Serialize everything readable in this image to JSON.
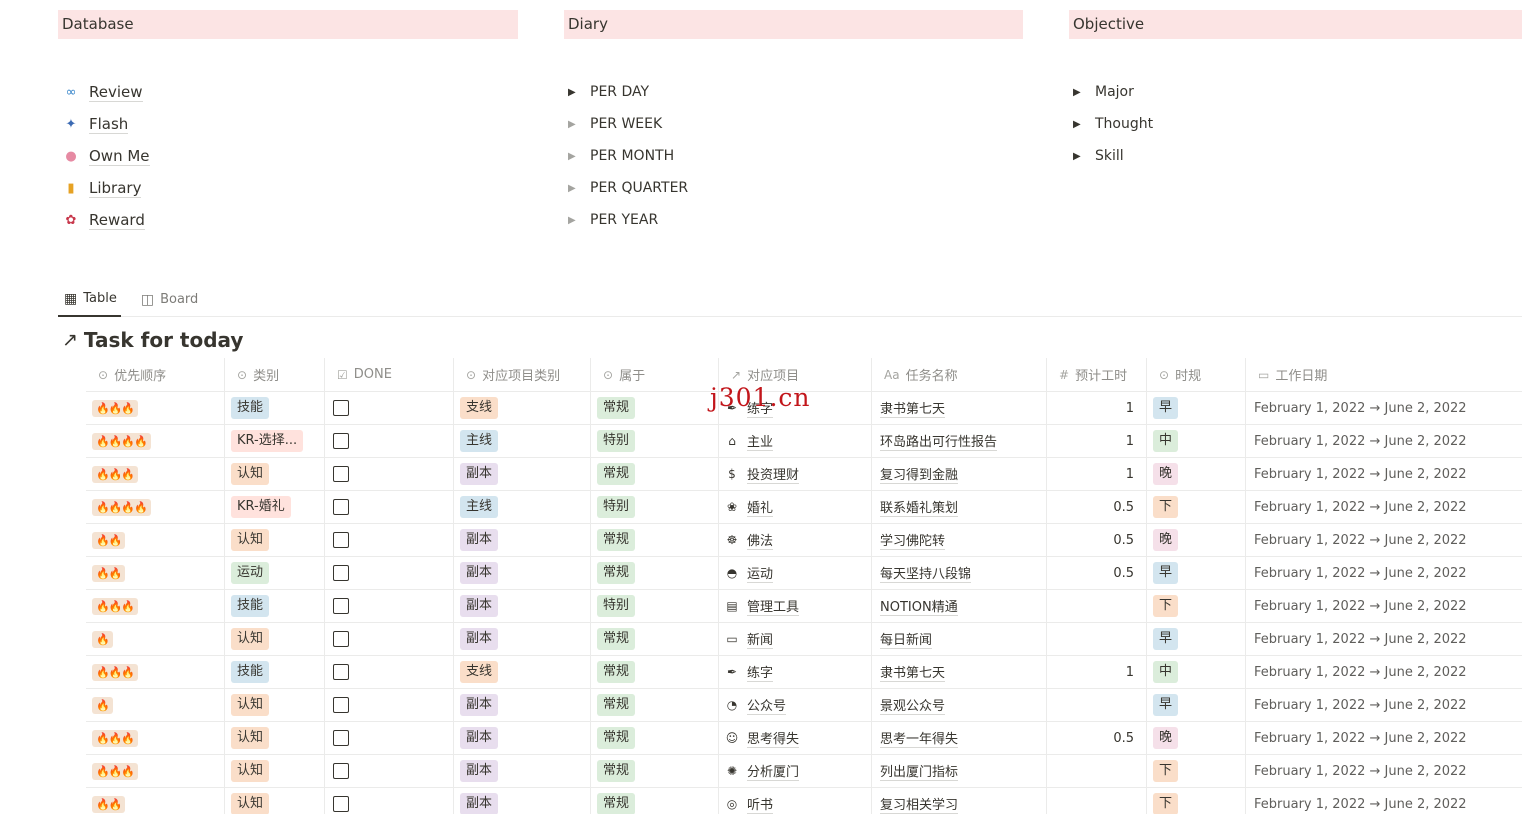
{
  "columns": {
    "database": {
      "title": "Database",
      "items": [
        {
          "icon": "infinity-icon",
          "glyph": "∞",
          "color": "#2f80c8",
          "label": "Review"
        },
        {
          "icon": "night-sky-icon",
          "glyph": "✦",
          "color": "#3b6ab3",
          "label": "Flash"
        },
        {
          "icon": "brain-icon",
          "glyph": "●",
          "color": "#e68aa3",
          "label": "Own Me"
        },
        {
          "icon": "books-icon",
          "glyph": "▮",
          "color": "#e6a224",
          "label": "Library"
        },
        {
          "icon": "candy-icon",
          "glyph": "✿",
          "color": "#c8384c",
          "label": "Reward"
        }
      ]
    },
    "diary": {
      "title": "Diary",
      "items": [
        "PER DAY",
        "PER WEEK",
        "PER MONTH",
        "PER QUARTER",
        "PER YEAR"
      ]
    },
    "objective": {
      "title": "Objective",
      "items": [
        "Major",
        "Thought",
        "Skill"
      ]
    }
  },
  "views": [
    {
      "icon": "table-icon",
      "glyph": "▦",
      "label": "Table",
      "active": true
    },
    {
      "icon": "board-icon",
      "glyph": "◫",
      "label": "Board",
      "active": false
    }
  ],
  "database_title": "Task for today",
  "table": {
    "headers": [
      {
        "icon": "select-icon",
        "glyph": "⊙",
        "label": "优先顺序"
      },
      {
        "icon": "select-icon",
        "glyph": "⊙",
        "label": "类别"
      },
      {
        "icon": "checkbox-icon",
        "glyph": "☑",
        "label": "DONE"
      },
      {
        "icon": "select-icon",
        "glyph": "⊙",
        "label": "对应项目类别"
      },
      {
        "icon": "select-icon",
        "glyph": "⊙",
        "label": "属于"
      },
      {
        "icon": "relation-icon",
        "glyph": "↗",
        "label": "对应项目"
      },
      {
        "icon": "title-icon",
        "glyph": "Aa",
        "label": "任务名称"
      },
      {
        "icon": "number-icon",
        "glyph": "#",
        "label": "预计工时"
      },
      {
        "icon": "select-icon",
        "glyph": "⊙",
        "label": "时规"
      },
      {
        "icon": "calendar-icon",
        "glyph": "▭",
        "label": "工作日期"
      }
    ],
    "rows": [
      {
        "priority": "🔥🔥🔥",
        "category": "技能",
        "catColor": "blue",
        "done": false,
        "projType": "支线",
        "ptColor": "orange",
        "belongs": "常规",
        "project": "练字",
        "picon": "✒",
        "task": "隶书第七天",
        "hours": "1",
        "slot": "早",
        "slotColor": "blue",
        "dates": "February 1, 2022 → June 2, 2022"
      },
      {
        "priority": "🔥🔥🔥🔥",
        "category": "KR-选择...",
        "catColor": "red",
        "done": false,
        "projType": "主线",
        "ptColor": "blue",
        "belongs": "特别",
        "project": "主业",
        "picon": "⌂",
        "task": "环岛路出可行性报告",
        "hours": "1",
        "slot": "中",
        "slotColor": "green",
        "dates": "February 1, 2022 → June 2, 2022"
      },
      {
        "priority": "🔥🔥🔥",
        "category": "认知",
        "catColor": "orange",
        "done": false,
        "projType": "副本",
        "ptColor": "purple",
        "belongs": "常规",
        "project": "投资理财",
        "picon": "$",
        "task": "复习得到金融",
        "hours": "1",
        "slot": "晚",
        "slotColor": "pink",
        "dates": "February 1, 2022 → June 2, 2022"
      },
      {
        "priority": "🔥🔥🔥🔥",
        "category": "KR-婚礼",
        "catColor": "red",
        "done": false,
        "projType": "主线",
        "ptColor": "blue",
        "belongs": "特别",
        "project": "婚礼",
        "picon": "❀",
        "task": "联系婚礼策划",
        "hours": "0.5",
        "slot": "下",
        "slotColor": "orange",
        "dates": "February 1, 2022 → June 2, 2022"
      },
      {
        "priority": "🔥🔥",
        "category": "认知",
        "catColor": "orange",
        "done": false,
        "projType": "副本",
        "ptColor": "purple",
        "belongs": "常规",
        "project": "佛法",
        "picon": "☸",
        "task": "学习佛陀转",
        "hours": "0.5",
        "slot": "晚",
        "slotColor": "pink",
        "dates": "February 1, 2022 → June 2, 2022"
      },
      {
        "priority": "🔥🔥",
        "category": "运动",
        "catColor": "green",
        "done": false,
        "projType": "副本",
        "ptColor": "purple",
        "belongs": "常规",
        "project": "运动",
        "picon": "◓",
        "task": "每天坚持八段锦",
        "hours": "0.5",
        "slot": "早",
        "slotColor": "blue",
        "dates": "February 1, 2022 → June 2, 2022"
      },
      {
        "priority": "🔥🔥🔥",
        "category": "技能",
        "catColor": "blue",
        "done": false,
        "projType": "副本",
        "ptColor": "purple",
        "belongs": "特别",
        "project": "管理工具",
        "picon": "▤",
        "task": "NOTION精通",
        "hours": "",
        "slot": "下",
        "slotColor": "orange",
        "dates": "February 1, 2022 → June 2, 2022"
      },
      {
        "priority": "🔥",
        "category": "认知",
        "catColor": "orange",
        "done": false,
        "projType": "副本",
        "ptColor": "purple",
        "belongs": "常规",
        "project": "新闻",
        "picon": "▭",
        "task": "每日新闻",
        "hours": "",
        "slot": "早",
        "slotColor": "blue",
        "dates": "February 1, 2022 → June 2, 2022"
      },
      {
        "priority": "🔥🔥🔥",
        "category": "技能",
        "catColor": "blue",
        "done": false,
        "projType": "支线",
        "ptColor": "orange",
        "belongs": "常规",
        "project": "练字",
        "picon": "✒",
        "task": "隶书第七天",
        "hours": "1",
        "slot": "中",
        "slotColor": "green",
        "dates": "February 1, 2022 → June 2, 2022"
      },
      {
        "priority": "🔥",
        "category": "认知",
        "catColor": "orange",
        "done": false,
        "projType": "副本",
        "ptColor": "purple",
        "belongs": "常规",
        "project": "公众号",
        "picon": "◔",
        "task": "景观公众号",
        "hours": "",
        "slot": "早",
        "slotColor": "blue",
        "dates": "February 1, 2022 → June 2, 2022"
      },
      {
        "priority": "🔥🔥🔥",
        "category": "认知",
        "catColor": "orange",
        "done": false,
        "projType": "副本",
        "ptColor": "purple",
        "belongs": "常规",
        "project": "思考得失",
        "picon": "☺",
        "task": "思考一年得失",
        "hours": "0.5",
        "slot": "晚",
        "slotColor": "pink",
        "dates": "February 1, 2022 → June 2, 2022"
      },
      {
        "priority": "🔥🔥🔥",
        "category": "认知",
        "catColor": "orange",
        "done": false,
        "projType": "副本",
        "ptColor": "purple",
        "belongs": "常规",
        "project": "分析厦门",
        "picon": "✺",
        "task": "列出厦门指标",
        "hours": "",
        "slot": "下",
        "slotColor": "orange",
        "dates": "February 1, 2022 → June 2, 2022"
      },
      {
        "priority": "🔥🔥",
        "category": "认知",
        "catColor": "orange",
        "done": false,
        "projType": "副本",
        "ptColor": "purple",
        "belongs": "常规",
        "project": "听书",
        "picon": "◎",
        "task": "复习相关学习",
        "hours": "",
        "slot": "下",
        "slotColor": "orange",
        "dates": "February 1, 2022 → June 2, 2022"
      }
    ]
  },
  "watermark": "j301.cn"
}
